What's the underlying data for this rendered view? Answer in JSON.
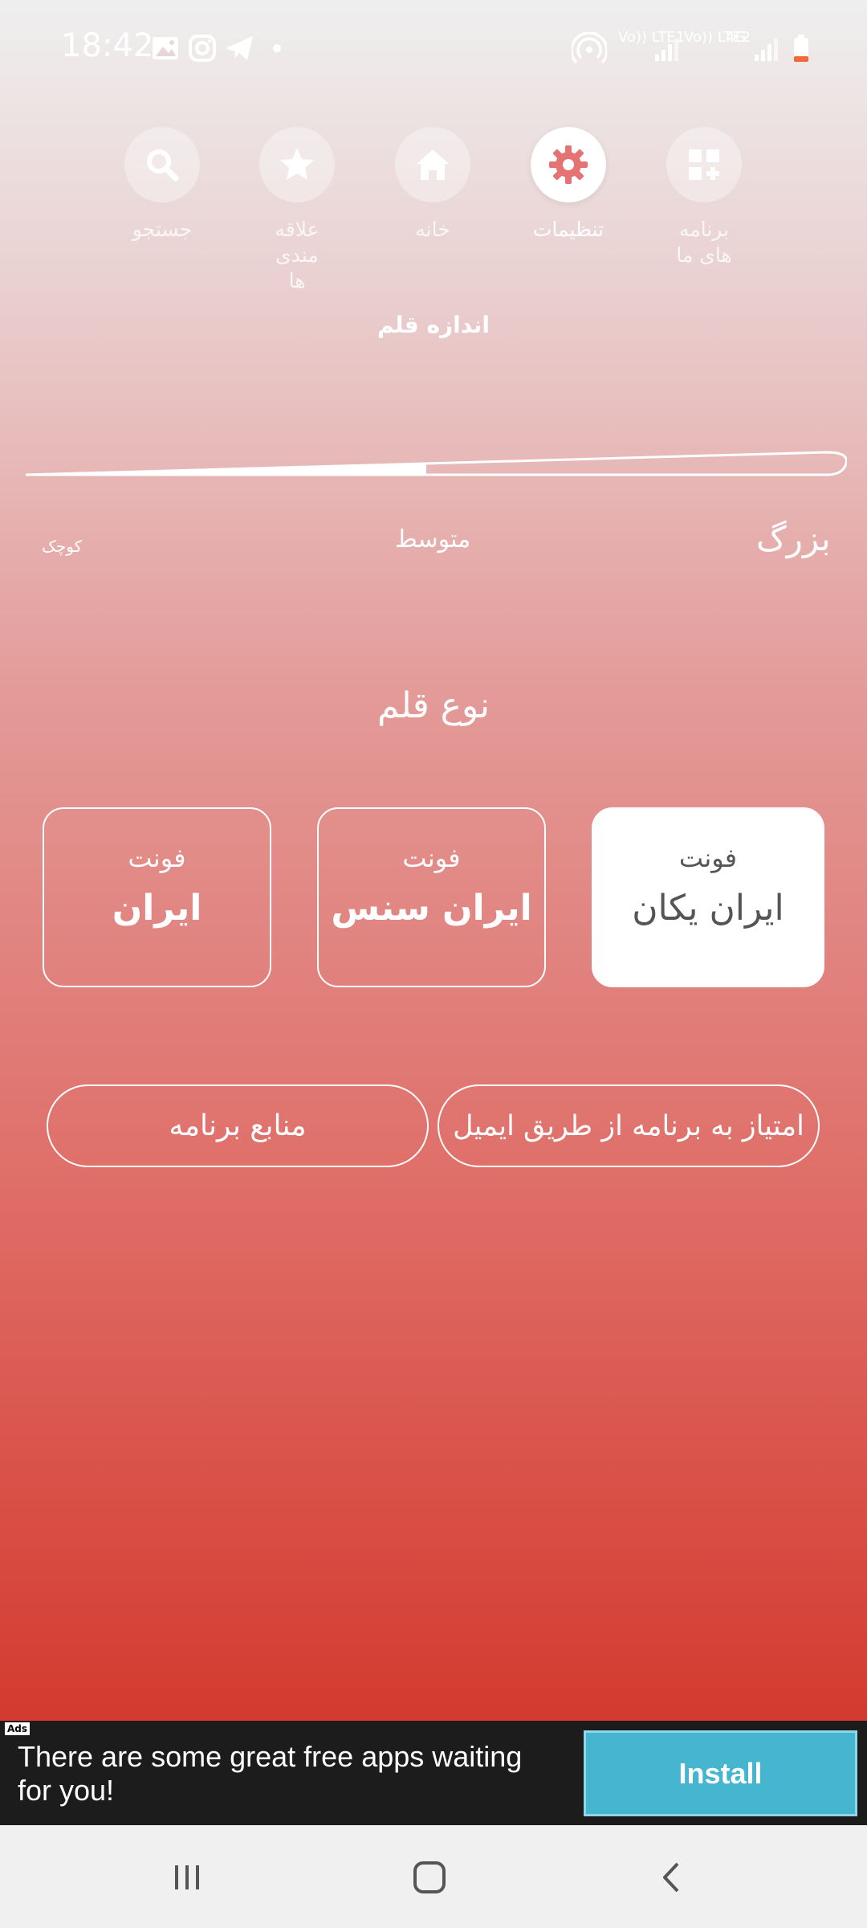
{
  "status_bar": {
    "time": "18:42",
    "sim1_label": "Vo)) LTE1",
    "sim2_label": "Vo)) LTE2",
    "net_type": "4G",
    "icons": [
      "image-icon",
      "instagram-icon",
      "telegram-icon",
      "dot-icon",
      "hotspot-icon",
      "signal-icon",
      "battery-icon"
    ]
  },
  "nav": {
    "items": [
      {
        "label": "جستجو",
        "icon": "search-icon"
      },
      {
        "label": "علاقه مندی ها",
        "icon": "star-icon"
      },
      {
        "label": "خانه",
        "icon": "home-icon"
      },
      {
        "label": "تنظیمات",
        "icon": "gear-icon"
      },
      {
        "label": "برنامه های ما",
        "icon": "apps-icon"
      }
    ],
    "active": "تنظیمات"
  },
  "font_size": {
    "title": "اندازه قلم",
    "small_label": "کوچک",
    "medium_label": "متوسط",
    "large_label": "بزرگ",
    "level": 0.5
  },
  "font_type": {
    "title": "نوع قلم",
    "cards": [
      {
        "line1": "فونت",
        "line2": "ایران یکان"
      },
      {
        "line1": "فونت",
        "line2": "ایران سنس"
      },
      {
        "line1": "فونت",
        "line2": "ایران"
      }
    ],
    "selected": "ایران یکان"
  },
  "buttons": {
    "rate": "امتیاز به برنامه از طریق ایمیل",
    "resources": "منابع برنامه"
  },
  "ad": {
    "badge": "Ads",
    "text": "There are some great free apps waiting for you!",
    "install": "Install"
  },
  "colors": {
    "accent_top": "#efefef",
    "accent_bottom": "#d43a2f",
    "ad_button": "#46b5cf"
  }
}
